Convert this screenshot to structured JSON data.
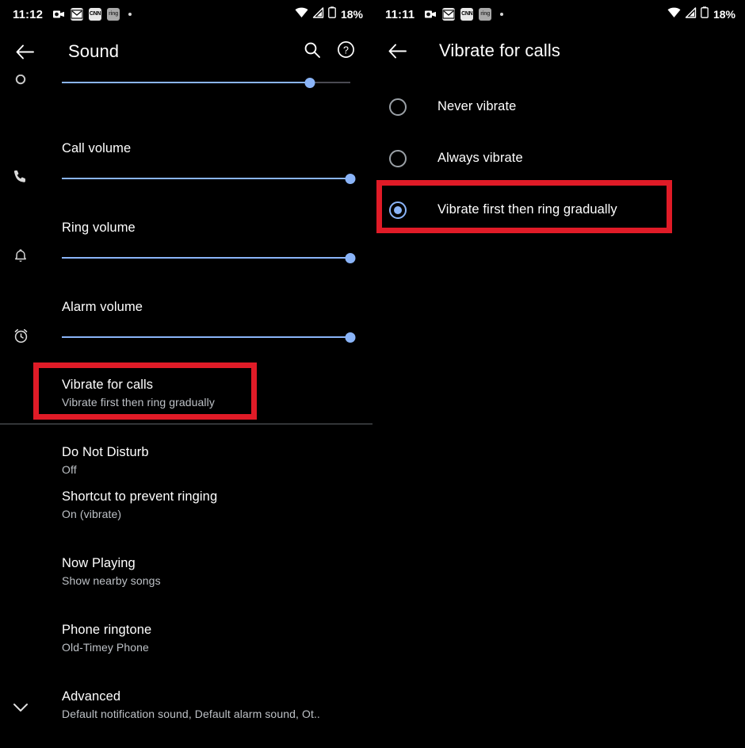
{
  "left_phone": {
    "statusbar": {
      "time": "11:12",
      "icons": [
        {
          "name": "outlook-icon",
          "glyph": "✉"
        },
        {
          "name": "gmail-icon",
          "glyph": "M"
        },
        {
          "name": "cnn-icon",
          "glyph": "CNN"
        },
        {
          "name": "ring-icon",
          "glyph": "ring"
        }
      ],
      "overflow_dot": "•",
      "wifi_label": "wifi-icon",
      "signal_label": "signal-icon",
      "battery_label": "battery-icon",
      "battery_percent": "18%"
    },
    "appbar": {
      "back_label": "Back",
      "title": "Sound",
      "search_label": "Search",
      "help_label": "Help"
    },
    "sliders": [
      {
        "icon": "media-volume-icon",
        "label": "",
        "fill_percent": 86,
        "thumb_percent": 86
      },
      {
        "icon": "phone-icon",
        "label": "Call volume",
        "fill_percent": 100,
        "thumb_percent": 100
      },
      {
        "icon": "bell-icon",
        "label": "Ring volume",
        "fill_percent": 100,
        "thumb_percent": 100
      },
      {
        "icon": "alarm-clock-icon",
        "label": "Alarm volume",
        "fill_percent": 100,
        "thumb_percent": 100
      }
    ],
    "highlighted_item": {
      "title": "Vibrate for calls",
      "subtitle": "Vibrate first then ring gradually"
    },
    "items": [
      {
        "title": "Do Not Disturb",
        "subtitle": "Off"
      },
      {
        "title": "Shortcut to prevent ringing",
        "subtitle": "On (vibrate)"
      },
      {
        "title": "Now Playing",
        "subtitle": "Show nearby songs"
      },
      {
        "title": "Phone ringtone",
        "subtitle": "Old-Timey Phone"
      },
      {
        "title": "Advanced",
        "subtitle": "Default notification sound, Default alarm sound, Ot.."
      }
    ]
  },
  "right_phone": {
    "statusbar": {
      "time": "11:11",
      "icons": [
        {
          "name": "outlook-icon",
          "glyph": "✉"
        },
        {
          "name": "gmail-icon",
          "glyph": "M"
        },
        {
          "name": "cnn-icon",
          "glyph": "CNN"
        },
        {
          "name": "ring-icon",
          "glyph": "ring"
        }
      ],
      "overflow_dot": "•",
      "battery_percent": "18%"
    },
    "appbar": {
      "back_label": "Back",
      "title": "Vibrate for calls"
    },
    "options": [
      {
        "label": "Never vibrate",
        "selected": false
      },
      {
        "label": "Always vibrate",
        "selected": false
      },
      {
        "label": "Vibrate first then ring gradually",
        "selected": true
      }
    ]
  },
  "colors": {
    "accent": "#8ab4f8",
    "highlight": "#e01b27",
    "background": "#000000",
    "secondary_text": "#bdc1c6"
  }
}
